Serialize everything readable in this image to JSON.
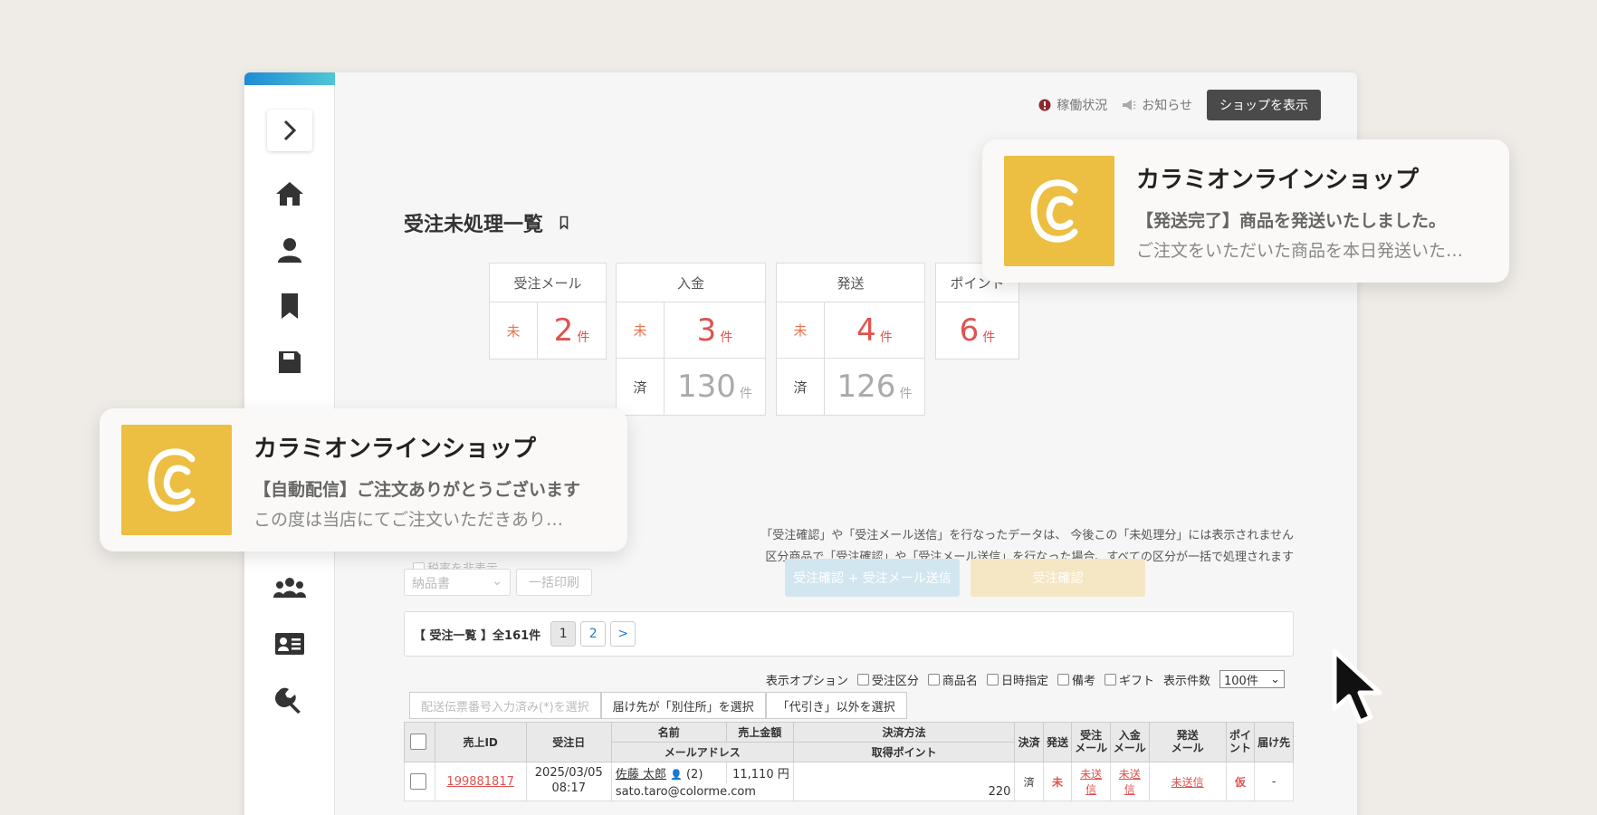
{
  "header": {
    "status_label": "稼働状況",
    "news_label": "お知らせ",
    "shop_button": "ショップを表示"
  },
  "page": {
    "title": "受注未処理一覧"
  },
  "stats": {
    "order_mail": {
      "label": "受注メール",
      "pending_label": "未",
      "pending_value": "2",
      "unit": "件"
    },
    "payment": {
      "label": "入金",
      "pending_label": "未",
      "pending_value": "3",
      "done_label": "済",
      "done_value": "130",
      "unit": "件"
    },
    "shipping": {
      "label": "発送",
      "pending_label": "未",
      "pending_value": "4",
      "done_label": "済",
      "done_value": "126",
      "unit": "件"
    },
    "points": {
      "label": "ポイント",
      "value": "6",
      "unit": "件"
    }
  },
  "notices": {
    "line1": "「受注確認」や「受注メール送信」を行なったデータは、 今後この「未処理分」には表示されません",
    "line2": "区分商品で「受注確認」や「受注メール送信」を行なった場合、すべての区分が一括で処理されます"
  },
  "actions": {
    "confirm_and_mail": "受注確認 + 受注メール送信",
    "confirm": "受注確認",
    "hide_tax_label": "税率を非表示",
    "doc_select": "納品書",
    "bulk_print": "一括印刷"
  },
  "list": {
    "summary": "【 受注一覧 】全161件",
    "pages": [
      "1",
      "2",
      ">"
    ]
  },
  "display_options": {
    "label": "表示オプション",
    "checks": [
      "受注区分",
      "商品名",
      "日時指定",
      "備考",
      "ギフト"
    ],
    "count_label": "表示件数",
    "count_value": "100件"
  },
  "filters": [
    "配送伝票番号入力済み(*)を選択",
    "届け先が「別住所」を選択",
    "「代引き」以外を選択"
  ],
  "table": {
    "headers": {
      "sale_id": "売上ID",
      "order_date": "受注日",
      "name": "名前",
      "amount": "売上金額",
      "email": "メールアドレス",
      "payment_method": "決済方法",
      "points": "取得ポイント",
      "settled": "決済",
      "shipped": "発送",
      "order_mail_1": "受注",
      "order_mail_2": "メール",
      "payment_mail_1": "入金",
      "payment_mail_2": "メール",
      "ship_mail_1": "発送",
      "ship_mail_2": "メール",
      "point_1": "ポイ",
      "point_2": "ント",
      "destination": "届け先"
    },
    "rows": [
      {
        "sale_id": "199881817",
        "date": "2025/03/05",
        "time": "08:17",
        "name": "佐藤 太郎",
        "count": "(2)",
        "amount": "11,110 円",
        "email": "sato.taro@colorme.com",
        "points": "220",
        "settled": "済",
        "shipped": "未",
        "order_mail": "未送信",
        "payment_mail": "未送信",
        "ship_mail": "未送信",
        "point": "仮",
        "destination": "-"
      }
    ]
  },
  "notifications": [
    {
      "title": "カラミオンラインショップ",
      "subject": "【発送完了】商品を発送いたしました。",
      "body": "ご注文をいただいた商品を本日発送いた…"
    },
    {
      "title": "カラミオンラインショップ",
      "subject": "【自動配信】ご注文ありがとうございます",
      "body": "この度は当店にてご注文いただきあり…"
    }
  ],
  "colors": {
    "accent_red": "#e0524f",
    "brand_yellow": "#ecbe42",
    "primary_blue_faded": "#d2e6f0",
    "confirm_yellow_faded": "#f5e6c4"
  }
}
